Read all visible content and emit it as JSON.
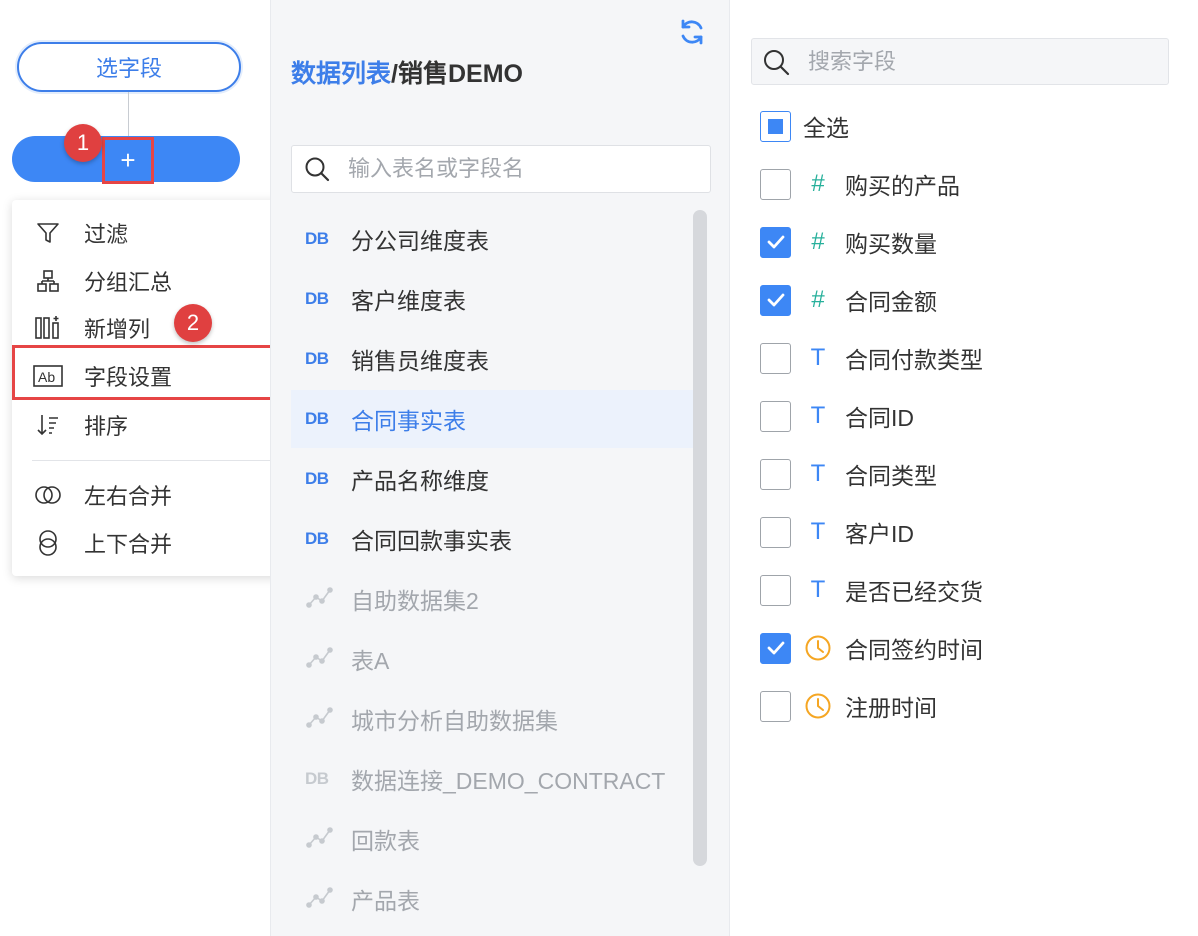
{
  "flow": {
    "step_label": "选字段",
    "add_symbol": "+",
    "badge1": "1",
    "badge2": "2",
    "menu": {
      "items": [
        {
          "label": "过滤",
          "icon": "filter-icon"
        },
        {
          "label": "分组汇总",
          "icon": "group-summary-icon"
        },
        {
          "label": "新增列",
          "icon": "add-column-icon"
        },
        {
          "label": "字段设置",
          "icon": "field-settings-icon"
        },
        {
          "label": "排序",
          "icon": "sort-icon"
        },
        {
          "label": "左右合并",
          "icon": "horizontal-merge-icon"
        },
        {
          "label": "上下合并",
          "icon": "vertical-merge-icon"
        }
      ]
    }
  },
  "tables": {
    "breadcrumb_link": "数据列表",
    "breadcrumb_sep": "/",
    "breadcrumb_current": "销售DEMO",
    "search_placeholder": "输入表名或字段名",
    "items": [
      {
        "label": "分公司维度表",
        "icon_text": "DB",
        "kind": "db",
        "active": false
      },
      {
        "label": "客户维度表",
        "icon_text": "DB",
        "kind": "db",
        "active": false
      },
      {
        "label": "销售员维度表",
        "icon_text": "DB",
        "kind": "db",
        "active": false
      },
      {
        "label": "合同事实表",
        "icon_text": "DB",
        "kind": "db",
        "active": true
      },
      {
        "label": "产品名称维度",
        "icon_text": "DB",
        "kind": "db",
        "active": false
      },
      {
        "label": "合同回款事实表",
        "icon_text": "DB",
        "kind": "db",
        "active": false
      },
      {
        "label": "自助数据集2",
        "icon_text": "",
        "kind": "dataset",
        "active": false
      },
      {
        "label": "表A",
        "icon_text": "",
        "kind": "dataset",
        "active": false
      },
      {
        "label": "城市分析自助数据集",
        "icon_text": "",
        "kind": "dataset",
        "active": false
      },
      {
        "label": "数据连接_DEMO_CONTRACT",
        "icon_text": "DB",
        "kind": "db-dim",
        "active": false
      },
      {
        "label": "回款表",
        "icon_text": "",
        "kind": "dataset",
        "active": false
      },
      {
        "label": "产品表",
        "icon_text": "",
        "kind": "dataset",
        "active": false
      }
    ]
  },
  "fields": {
    "search_placeholder": "搜索字段",
    "select_all_label": "全选",
    "items": [
      {
        "label": "购买的产品",
        "type": "number",
        "type_glyph": "#",
        "checked": false
      },
      {
        "label": "购买数量",
        "type": "number",
        "type_glyph": "#",
        "checked": true
      },
      {
        "label": "合同金额",
        "type": "number",
        "type_glyph": "#",
        "checked": true
      },
      {
        "label": "合同付款类型",
        "type": "text",
        "type_glyph": "T",
        "checked": false
      },
      {
        "label": "合同ID",
        "type": "text",
        "type_glyph": "T",
        "checked": false
      },
      {
        "label": "合同类型",
        "type": "text",
        "type_glyph": "T",
        "checked": false
      },
      {
        "label": "客户ID",
        "type": "text",
        "type_glyph": "T",
        "checked": false
      },
      {
        "label": "是否已经交货",
        "type": "text",
        "type_glyph": "T",
        "checked": false
      },
      {
        "label": "合同签约时间",
        "type": "date",
        "type_glyph": "",
        "checked": true
      },
      {
        "label": "注册时间",
        "type": "date",
        "type_glyph": "",
        "checked": false
      }
    ]
  }
}
